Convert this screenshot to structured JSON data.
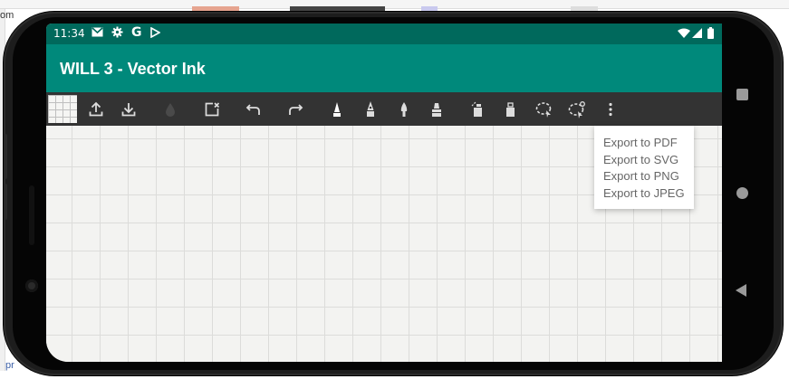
{
  "background": {
    "left_fragment_top": "om",
    "left_fragment_bottom": "pr"
  },
  "status_bar": {
    "time": "11:34",
    "left_icons": [
      "gmail-icon",
      "settings-icon",
      "google-icon",
      "play-store-icon"
    ],
    "right_icons": [
      "wifi-icon",
      "signal-icon",
      "battery-icon"
    ]
  },
  "app_bar": {
    "title": "WILL 3 - Vector Ink",
    "color": "#00897b",
    "status_color": "#00695c"
  },
  "toolbar": {
    "background": "#333333",
    "tools": [
      {
        "name": "background-grid",
        "icon": "grid-thumbnail"
      },
      {
        "name": "upload",
        "icon": "upload-icon"
      },
      {
        "name": "download",
        "icon": "download-icon"
      },
      {
        "name": "color",
        "icon": "ink-drop-icon"
      },
      {
        "name": "clear",
        "icon": "clear-canvas-icon"
      },
      {
        "name": "undo",
        "icon": "undo-icon"
      },
      {
        "name": "redo",
        "icon": "redo-icon"
      },
      {
        "name": "pencil",
        "icon": "pencil-icon"
      },
      {
        "name": "fountain-pen",
        "icon": "fountain-pen-icon"
      },
      {
        "name": "brush",
        "icon": "brush-icon"
      },
      {
        "name": "marker",
        "icon": "marker-icon"
      },
      {
        "name": "partial-eraser",
        "icon": "partial-eraser-icon"
      },
      {
        "name": "whole-eraser",
        "icon": "whole-eraser-icon"
      },
      {
        "name": "selection",
        "icon": "lasso-select-icon"
      },
      {
        "name": "whole-selection",
        "icon": "lasso-whole-select-icon"
      },
      {
        "name": "more",
        "icon": "more-vert-icon"
      }
    ]
  },
  "export_menu": {
    "items": [
      {
        "label": "Export to PDF"
      },
      {
        "label": "Export to SVG"
      },
      {
        "label": "Export to PNG"
      },
      {
        "label": "Export to JPEG"
      }
    ]
  },
  "nav_bar": {
    "buttons": [
      "overview-square-icon",
      "home-circle-icon",
      "back-triangle-icon"
    ]
  }
}
